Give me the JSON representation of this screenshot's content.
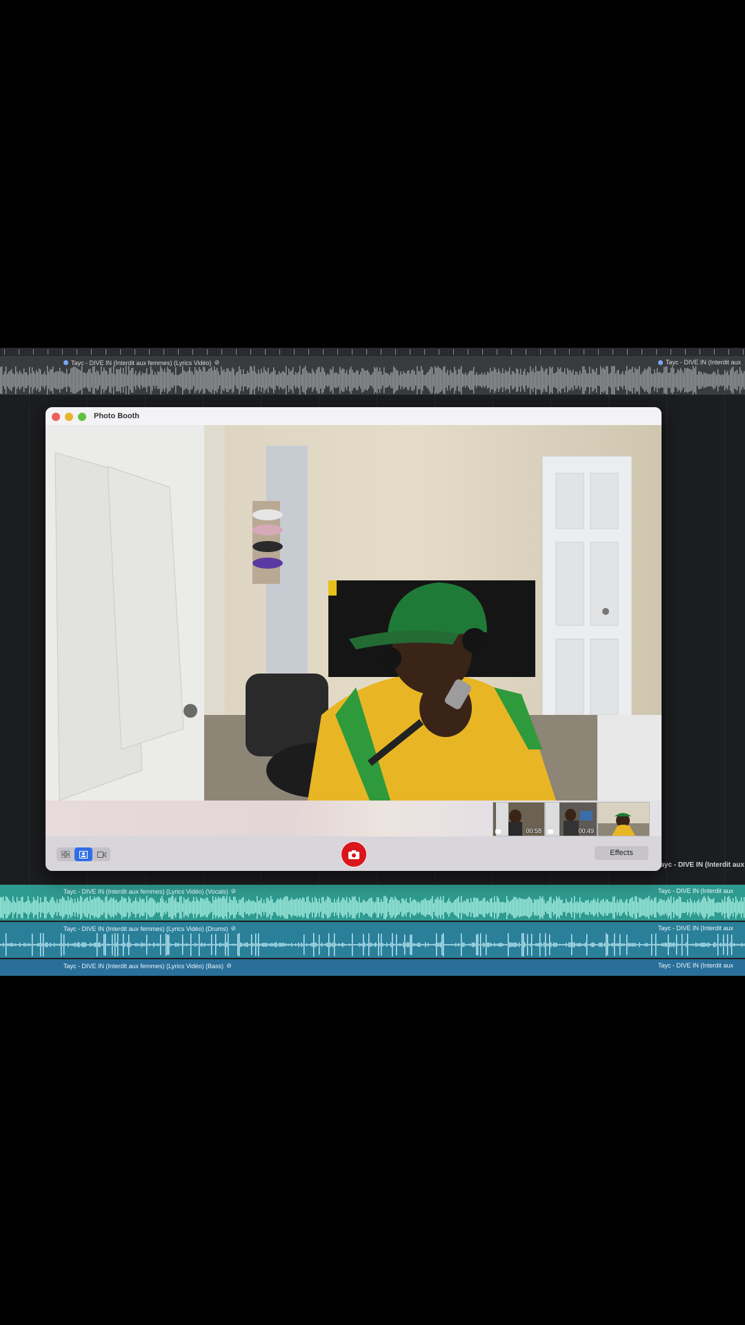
{
  "daw": {
    "main_track": {
      "name": "Tayc - DIVE IN (Interdit aux femmes) (Lyrics Vidéo)",
      "name_right": "Tayc - DIVE IN (Interdit aux"
    },
    "stray_label": "Tayc - DIVE IN (Interdit aux f",
    "stems": [
      {
        "name": "Tayc - DIVE IN (Interdit aux femmes) (Lyrics Vidéo) (Vocals)",
        "name_right": "Tayc - DIVE IN (Interdit aux",
        "color": "#2f9a8f"
      },
      {
        "name": "Tayc - DIVE IN (Interdit aux femmes) (Lyrics Vidéo) (Drums)",
        "name_right": "Tayc - DIVE IN (Interdit aux",
        "color": "#2a7f99"
      },
      {
        "name": "Tayc - DIVE IN (Interdit aux femmes) (Lyrics Vidéo) (Bass)",
        "name_right": "Tayc - DIVE IN (Interdit aux",
        "color": "#2a6f99"
      }
    ],
    "link_icon": "link-icon"
  },
  "window": {
    "title": "Photo Booth",
    "traffic_lights": {
      "close": "#ec5f58",
      "minimize": "#e6b52d",
      "maximize": "#5fc23f"
    },
    "thumbnails": [
      {
        "duration": "00:58",
        "kind": "video"
      },
      {
        "duration": "00:49",
        "kind": "video"
      },
      {
        "duration": "",
        "kind": "photo"
      }
    ],
    "toolbar": {
      "view_modes": [
        "grid-view-icon",
        "single-photo-icon",
        "video-icon"
      ],
      "active_mode": "single-photo-icon",
      "shutter_icon": "camera-icon",
      "effects_label": "Effects",
      "accent": "#2f6ee6",
      "shutter_color": "#d9161b"
    }
  }
}
